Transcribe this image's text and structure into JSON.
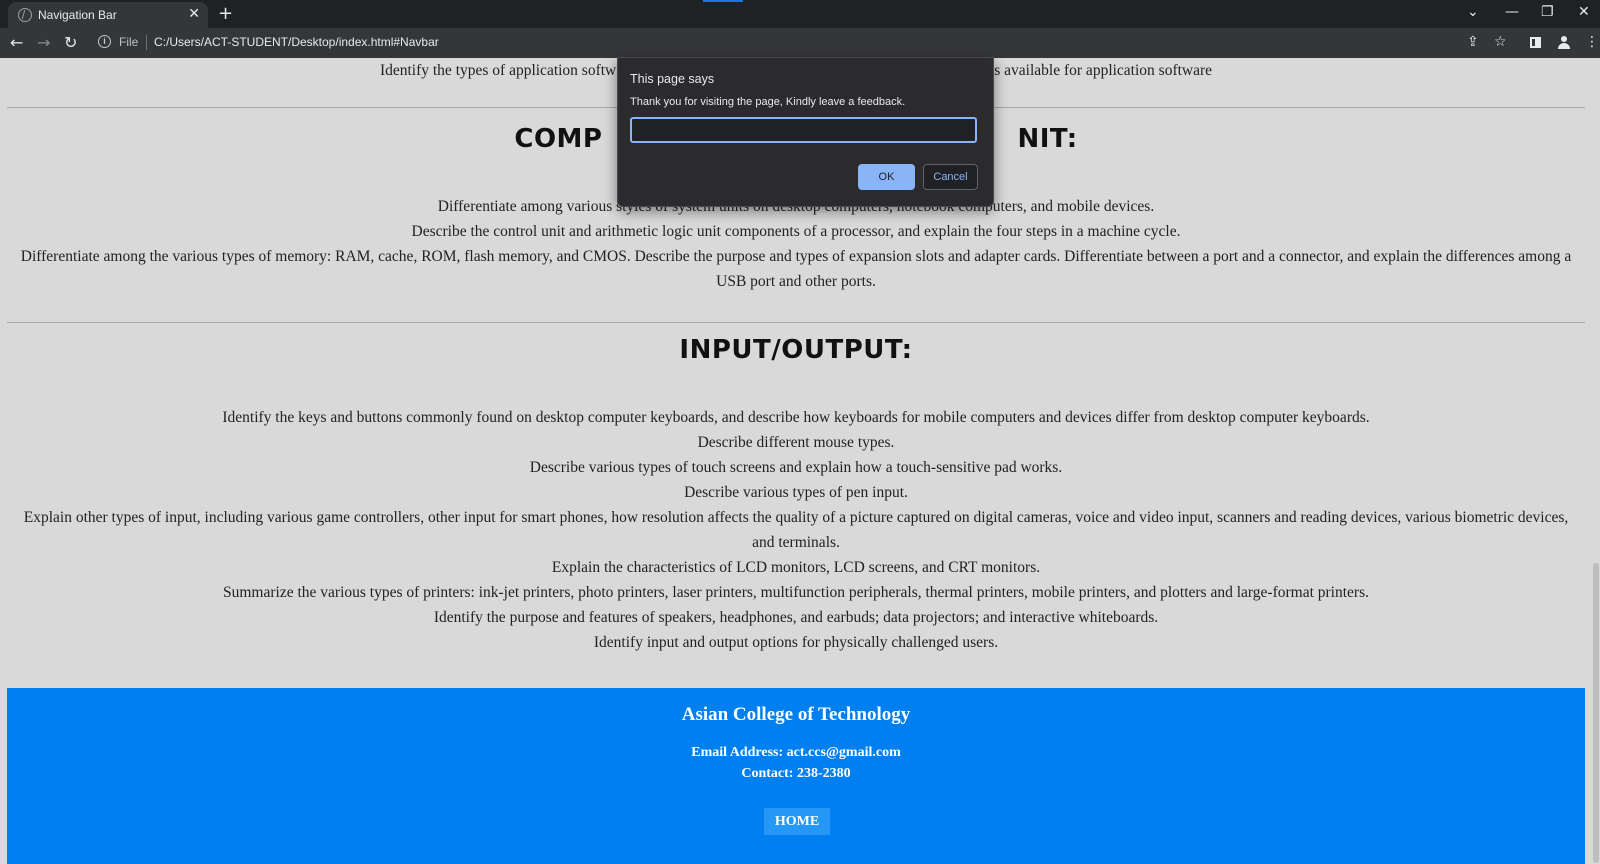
{
  "browser": {
    "tab_title": "Navigation Bar",
    "tab_close": "✕",
    "new_tab": "+",
    "scheme_label": "File",
    "url": "C:/Users/ACT-STUDENT/Desktop/index.html#Navbar",
    "info_glyph": "i",
    "icons": [
      "back-arrow-icon",
      "forward-arrow-icon",
      "reload-icon",
      "info-icon",
      "share-icon",
      "star-icon",
      "side-panel-icon",
      "profile-icon",
      "kebab-menu-icon",
      "tab-search-icon",
      "minimize-icon",
      "restore-icon",
      "close-icon"
    ],
    "glyphs": {
      "back": "←",
      "forward": "→",
      "reload": "↻",
      "share": "⇪",
      "star": "☆",
      "menu": "⋮",
      "tab_search": "⌄",
      "minimize": "—",
      "restore": "❐",
      "close": "✕"
    }
  },
  "content": {
    "top_line_left": "Identify the types of application softw",
    "top_line_right": "s available for application software",
    "system_unit": {
      "heading_left": "COMP",
      "heading_right": "NIT:",
      "lines": [
        "Differentiate among various styles of system units on desktop computers, notebook computers, and mobile devices.",
        "Describe the control unit and arithmetic logic unit components of a processor, and explain the four steps in a machine cycle.",
        "Differentiate among the various types of memory: RAM, cache, ROM, flash memory, and CMOS. Describe the purpose and types of expansion slots and adapter cards. Differentiate between a port and a connector, and explain the differences among a USB port and other ports."
      ]
    },
    "input_output": {
      "heading": "INPUT/OUTPUT:",
      "lines": [
        "Identify the keys and buttons commonly found on desktop computer keyboards, and describe how keyboards for mobile computers and devices differ from desktop computer keyboards.",
        "Describe different mouse types.",
        "Describe various types of touch screens and explain how a touch-sensitive pad works.",
        "Describe various types of pen input.",
        "Explain other types of input, including various game controllers, other input for smart phones, how resolution affects the quality of a picture captured on digital cameras, voice and video input, scanners and reading devices, various biometric devices, and terminals.",
        "Explain the characteristics of LCD monitors, LCD screens, and CRT monitors.",
        "Summarize the various types of printers: ink-jet printers, photo printers, laser printers, multifunction peripherals, thermal printers, mobile printers, and plotters and large-format printers.",
        "Identify the purpose and features of speakers, headphones, and earbuds; data projectors; and interactive whiteboards.",
        "Identify input and output options for physically challenged users."
      ]
    }
  },
  "footer": {
    "college": "Asian College of Technology",
    "email": "Email Address: act.ccs@gmail.com",
    "contact": "Contact: 238-2380",
    "home_label": "HOME"
  },
  "dialog": {
    "title": "This page says",
    "message": "Thank you for visiting the page, Kindly leave a feedback.",
    "input_value": "",
    "ok_label": "OK",
    "cancel_label": "Cancel"
  },
  "colors": {
    "footer_bg": "#0080f0",
    "page_bg": "#d9d9d9",
    "dialog_bg": "#2b2b2e",
    "primary_button": "#8ab4f8"
  }
}
